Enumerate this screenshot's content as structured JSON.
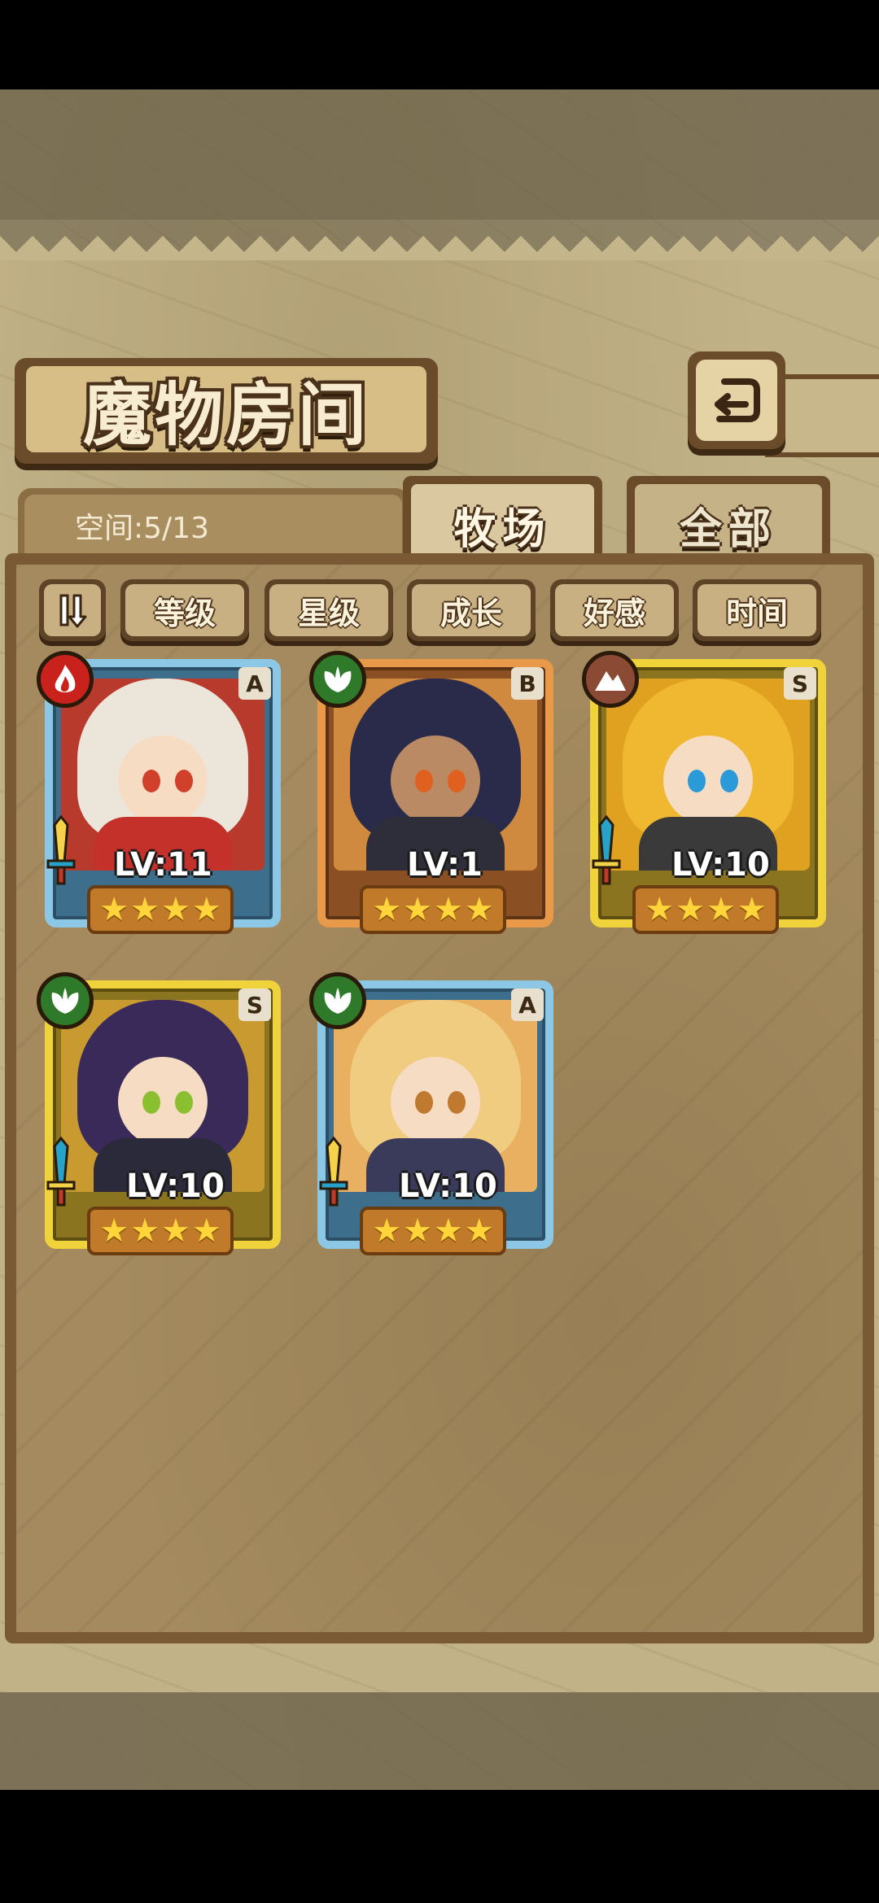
{
  "title": "魔物房间",
  "space": {
    "label": "空间:5/13"
  },
  "tabs": [
    {
      "label": "牧场",
      "active": true
    },
    {
      "label": "全部",
      "active": false
    }
  ],
  "sort_buttons": [
    "等级",
    "星级",
    "成长",
    "好感",
    "时间"
  ],
  "monsters": [
    {
      "level": "LV:11",
      "rank": "A",
      "element": "fire",
      "stars": 4,
      "frame": "blue"
    },
    {
      "level": "LV:1",
      "rank": "B",
      "element": "leaf",
      "stars": 4,
      "frame": "orange"
    },
    {
      "level": "LV:10",
      "rank": "S",
      "element": "earth",
      "stars": 4,
      "frame": "gold"
    },
    {
      "level": "LV:10",
      "rank": "S",
      "element": "leaf",
      "stars": 4,
      "frame": "gold"
    },
    {
      "level": "LV:10",
      "rank": "A",
      "element": "leaf",
      "stars": 4,
      "frame": "blue"
    }
  ],
  "colors": {
    "fire": "#c9211c",
    "leaf": "#2e7a2a",
    "earth": "#8a4a34",
    "star": "#ffd53a"
  }
}
